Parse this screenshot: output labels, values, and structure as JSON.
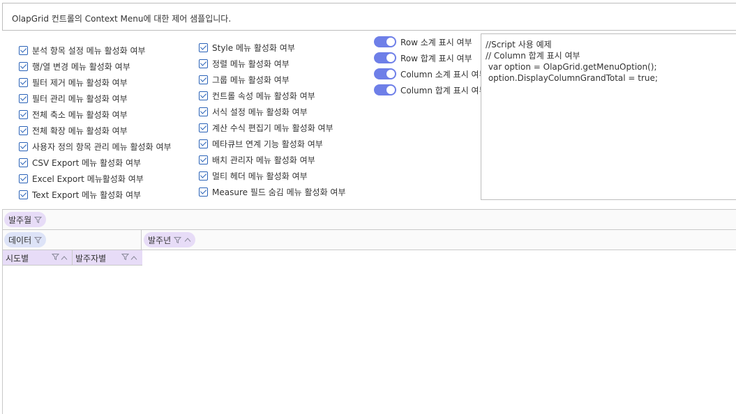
{
  "header": {
    "description": "OlapGrid 컨트롤의  Context Menu에 대한 제어 샘플입니다."
  },
  "checkboxes_left": [
    {
      "label": "분석 항목 설정 메뉴 활성화 여부",
      "checked": true
    },
    {
      "label": "행/열 변경 메뉴 활성화 여부",
      "checked": true
    },
    {
      "label": "필터 제거 메뉴 활성화 여부",
      "checked": true
    },
    {
      "label": "필터 관리 메뉴 활성화 여부",
      "checked": true
    },
    {
      "label": "전체 축소 메뉴 활성화 여부",
      "checked": true
    },
    {
      "label": "전체 확장 메뉴 활성화 여부",
      "checked": true
    },
    {
      "label": "사용자 정의 항목 관리 메뉴 활성화 여부",
      "checked": true
    },
    {
      "label": "CSV Export 메뉴 활성화 여부",
      "checked": true
    },
    {
      "label": "Excel Export 메뉴활성화 여부",
      "checked": true
    },
    {
      "label": "Text Export 메뉴 활성화 여부",
      "checked": true
    }
  ],
  "checkboxes_right": [
    {
      "label": "Style 메뉴 활성화 여부",
      "checked": true
    },
    {
      "label": "정렬 메뉴 활성화 여부",
      "checked": true
    },
    {
      "label": "그룹 메뉴 활성화 여부",
      "checked": true
    },
    {
      "label": "컨트롤 속성 메뉴 활성화 여부",
      "checked": true
    },
    {
      "label": "서식 설정 메뉴 활성화 여부",
      "checked": true
    },
    {
      "label": "계산 수식 편집기 메뉴 활성화 여부",
      "checked": true
    },
    {
      "label": "메타큐브 연계 기능 활성화 여부",
      "checked": true
    },
    {
      "label": "배치 관리자 메뉴 활성화 여부",
      "checked": true
    },
    {
      "label": "멀티 헤더 메뉴 활성화 여부",
      "checked": true
    },
    {
      "label": "Measure 필드 숨김 메뉴 활성화 여부",
      "checked": true
    }
  ],
  "toggles": [
    {
      "label": "Row 소계 표시 여부",
      "on": true
    },
    {
      "label": "Row 합계 표시 여부",
      "on": true
    },
    {
      "label": "Column 소계 표시 여부",
      "on": true
    },
    {
      "label": "Column 합계 표시 여부",
      "on": true
    }
  ],
  "script": {
    "lines": [
      "//Script 사용 예제",
      "// Column 합계 표시 여부",
      " var option = OlapGrid.getMenuOption();",
      " option.DisplayColumnGrandTotal = true;"
    ]
  },
  "grid": {
    "filter_field": "발주월",
    "data_field": "데이터",
    "column_field": "발주년",
    "row_fields": [
      "시도별",
      "발주자별"
    ]
  },
  "colors": {
    "accent": "#6e7fe8",
    "checkbox": "#2b63b8",
    "chip_purple": "#e7dcf7",
    "chip_blue": "#dde3f7"
  },
  "icons": {
    "filter": "filter-icon",
    "sort": "sort-asc-icon"
  }
}
